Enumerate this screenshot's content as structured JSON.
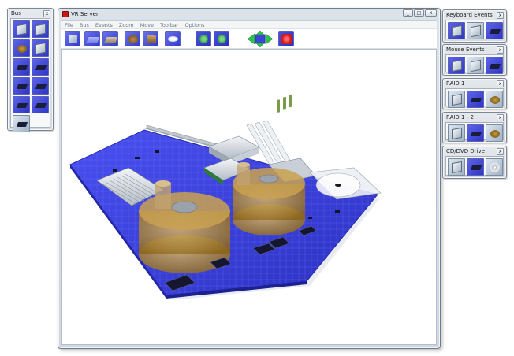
{
  "bus_panel": {
    "title": "Bus",
    "close": "x",
    "item_count": 10
  },
  "main_window": {
    "title": "VR Server",
    "controls": {
      "minimize": "_",
      "maximize": "□",
      "close": "x"
    },
    "menu": [
      "File",
      "Bus",
      "Events",
      "Zoom",
      "Move",
      "Toolbar",
      "Options"
    ]
  },
  "right_panels": {
    "keyboard_events": {
      "title": "Keyboard Events",
      "close": "x"
    },
    "mouse_events": {
      "title": "Mouse Events",
      "close": "x"
    },
    "raid_1": {
      "title": "RAID 1",
      "close": "x"
    },
    "raid_1_2": {
      "title": "RAID 1 - 2",
      "close": "x"
    },
    "cd_dvd_drive": {
      "title": "CD/DVD Drive",
      "close": "x"
    }
  },
  "colors": {
    "board": "#3b3fe0",
    "board_edge": "#2428a8",
    "tank": "#b88a2c",
    "toolbar_icon": "#3f47d6",
    "green_arrows": "#2fc24a",
    "stop_button": "#d41818"
  },
  "icons": {
    "toolbar": [
      "view-cube-icon",
      "pcb-board-icon",
      "pcb-board-icon",
      "tank-icon",
      "drive-icon",
      "eye-icon",
      "zoom-in-icon",
      "zoom-out-icon",
      "arrow-pad-icon",
      "stop-icon"
    ]
  }
}
